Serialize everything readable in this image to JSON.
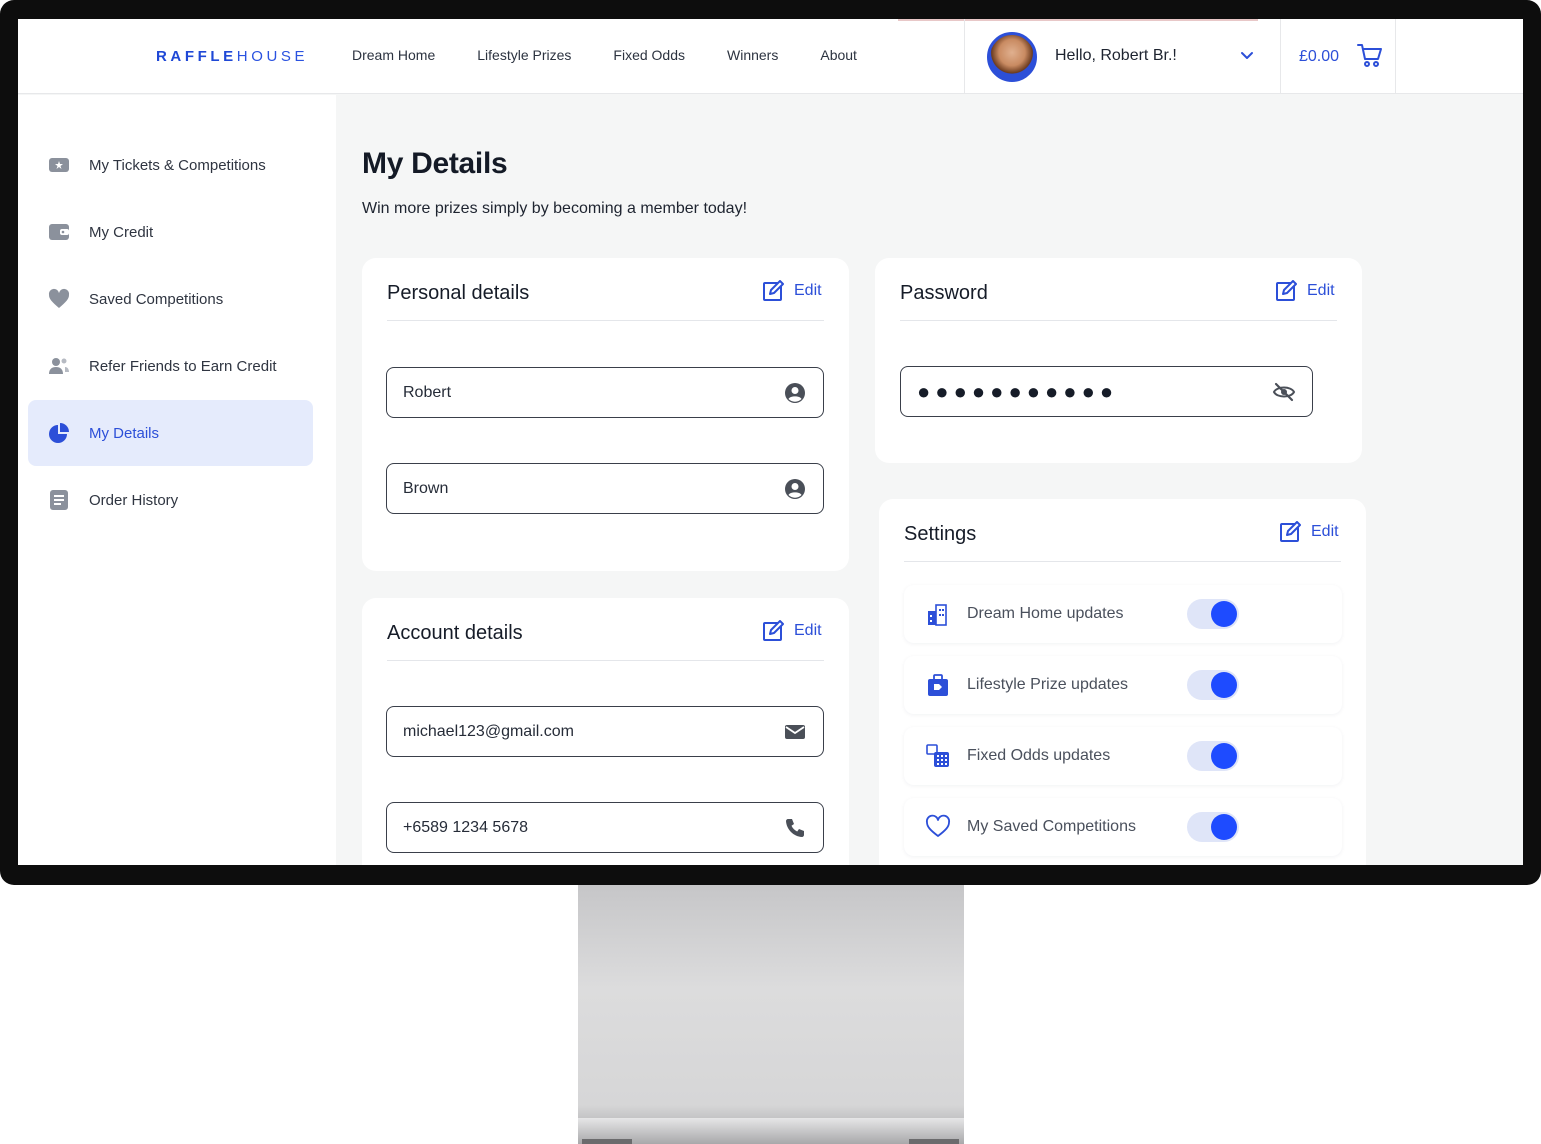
{
  "brand": {
    "name_bold": "RAFFLE",
    "name_light": "HOUSE"
  },
  "nav": [
    "Dream Home",
    "Lifestyle Prizes",
    "Fixed Odds",
    "Winners",
    "About"
  ],
  "user": {
    "greeting": "Hello, Robert Br.!"
  },
  "cart": {
    "amount": "£0.00"
  },
  "sidebar": {
    "items": [
      {
        "label": "My Tickets & Competitions",
        "icon": "ticket-icon",
        "active": false
      },
      {
        "label": "My Credit",
        "icon": "wallet-icon",
        "active": false
      },
      {
        "label": "Saved Competitions",
        "icon": "heart-icon",
        "active": false
      },
      {
        "label": "Refer Friends to Earn Credit",
        "icon": "users-icon",
        "active": false
      },
      {
        "label": "My Details",
        "icon": "pie-chart-icon",
        "active": true
      },
      {
        "label": "Order History",
        "icon": "document-icon",
        "active": false
      }
    ]
  },
  "page": {
    "title": "My Details",
    "subtitle": "Win more prizes simply by becoming a member today!"
  },
  "personal": {
    "title": "Personal details",
    "edit_label": "Edit",
    "first_name": "Robert",
    "last_name": "Brown"
  },
  "account": {
    "title": "Account details",
    "edit_label": "Edit",
    "email": "michael123@gmail.com",
    "phone": "+6589 1234 5678"
  },
  "password": {
    "title": "Password",
    "edit_label": "Edit",
    "masked": "●●●●●●●●●●●"
  },
  "settings": {
    "title": "Settings",
    "edit_label": "Edit",
    "rows": [
      {
        "label": "Dream Home updates",
        "icon": "building-icon",
        "enabled": true
      },
      {
        "label": "Lifestyle Prize updates",
        "icon": "suitcase-icon",
        "enabled": true
      },
      {
        "label": "Fixed Odds updates",
        "icon": "calculator-icon",
        "enabled": true
      },
      {
        "label": "My Saved Competitions",
        "icon": "heart-outline-icon",
        "enabled": true
      }
    ]
  },
  "colors": {
    "accent": "#2c4fd8",
    "toggle_on": "#1e4bff",
    "active_bg": "#e5ebfc"
  }
}
